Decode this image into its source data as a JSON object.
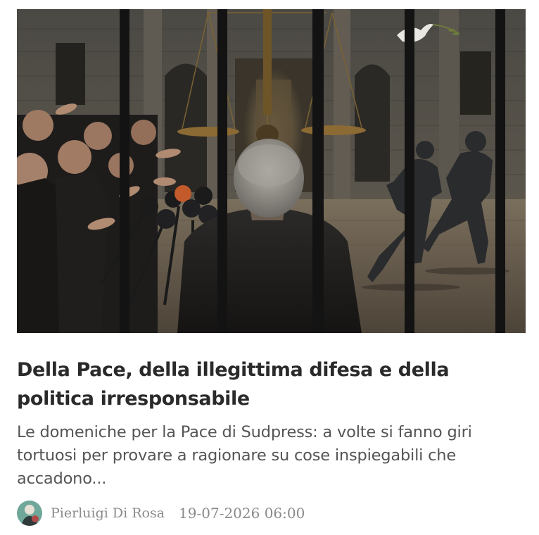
{
  "article": {
    "image_subject": "hero-illustration",
    "title": "Della Pace, della illegittima difesa e della politica irresponsabile",
    "excerpt": "Le domeniche per la Pace di Sudpress: a volte si fanno giri tortuosi per provare a ragionare su cose inspiegabili che accadono...",
    "author": "Pierluigi Di Rosa",
    "date": "19-07-2026 06:00"
  },
  "colors": {
    "title": "#2a2a2a",
    "excerpt": "#555555",
    "meta": "#8a8a8a",
    "avatar_bg": "#6fa79b"
  }
}
